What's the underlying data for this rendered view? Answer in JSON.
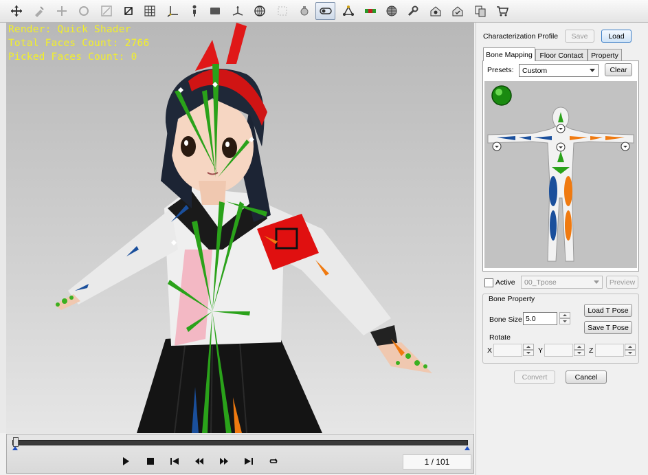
{
  "toolbar": {
    "buttons": [
      {
        "name": "select-move-icon"
      },
      {
        "name": "edit-pick-icon"
      },
      {
        "name": "move-icon"
      },
      {
        "name": "rotate-icon"
      },
      {
        "name": "scale-icon"
      },
      {
        "name": "wireframe-toggle-icon"
      },
      {
        "name": "grid-icon"
      },
      {
        "name": "axis-icon"
      },
      {
        "name": "figure-icon"
      },
      {
        "name": "plane-icon"
      },
      {
        "name": "pivot-icon"
      },
      {
        "name": "globe-icon"
      },
      {
        "name": "bounding-box-icon"
      },
      {
        "name": "light-icon"
      },
      {
        "name": "camera-toggle-icon",
        "active": true
      },
      {
        "name": "triangle-nodes-icon"
      },
      {
        "name": "color-capsule-icon"
      },
      {
        "name": "sphere-grid-icon"
      },
      {
        "name": "wrench-icon"
      },
      {
        "name": "house-gear-icon"
      },
      {
        "name": "house-check-icon"
      },
      {
        "name": "copy-pages-icon"
      },
      {
        "name": "cart-icon"
      }
    ]
  },
  "viewport": {
    "hud": {
      "render": "Render: Quick Shader",
      "total_faces": "Total Faces Count: 2766",
      "picked_faces": "Picked Faces Count: 0"
    }
  },
  "timeline": {
    "frame_counter": "1 / 101",
    "controls": [
      "play-icon",
      "stop-icon",
      "skip-start-icon",
      "rewind-icon",
      "fast-forward-icon",
      "skip-end-icon",
      "loop-icon"
    ]
  },
  "panel": {
    "characterization_label": "Characterization Profile",
    "save_label": "Save",
    "load_label": "Load",
    "tabs": [
      {
        "label": "Bone Mapping",
        "active": true
      },
      {
        "label": "Floor Contact",
        "active": false
      },
      {
        "label": "Property",
        "active": false
      }
    ],
    "presets_label": "Presets:",
    "presets_value": "Custom",
    "clear_label": "Clear",
    "active_label": "Active",
    "tpose_value": "00_Tpose",
    "preview_label": "Preview",
    "bone_property_label": "Bone Property",
    "load_tpose_label": "Load T Pose",
    "save_tpose_label": "Save T Pose",
    "bone_size_label": "Bone Size",
    "bone_size_value": "5.0",
    "rotate_label": "Rotate",
    "x_label": "X",
    "y_label": "Y",
    "z_label": "Z",
    "convert_label": "Convert",
    "cancel_label": "Cancel"
  },
  "colors": {
    "hud_text": "#f2ef2a",
    "bone_green": "#2aa21a",
    "bone_blue": "#1a4f9c",
    "bone_orange": "#f07a10",
    "armband_red": "#e01010"
  }
}
